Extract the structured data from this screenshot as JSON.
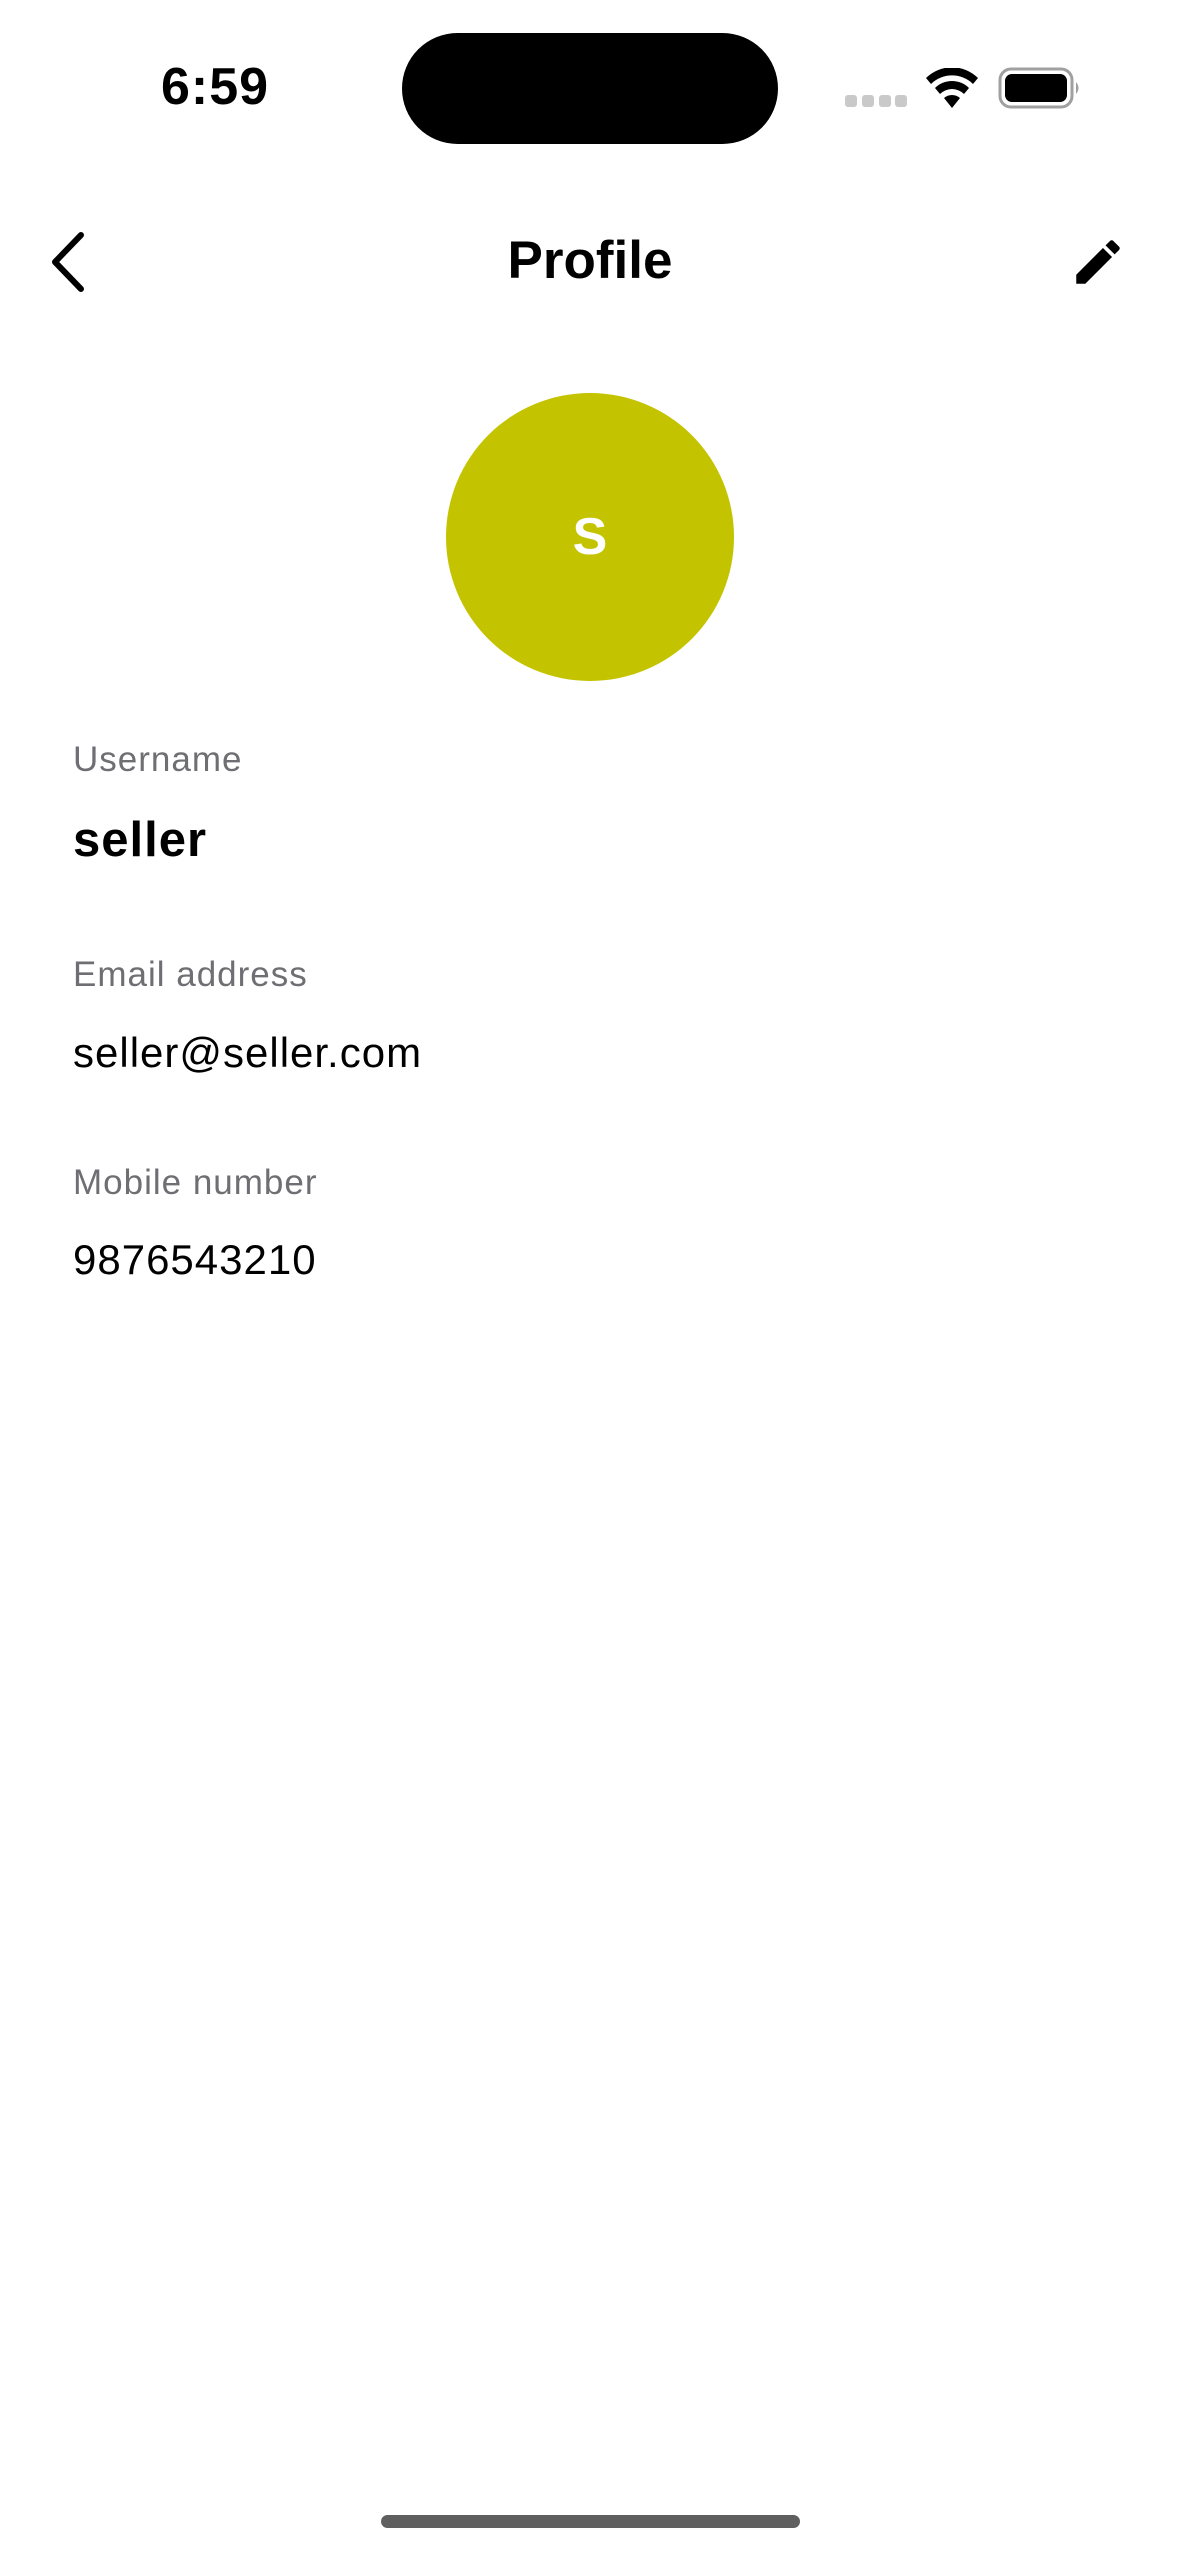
{
  "status_bar": {
    "time": "6:59",
    "icons": [
      "signal-icon",
      "wifi-icon",
      "battery-icon"
    ]
  },
  "nav": {
    "title": "Profile",
    "back_icon": "chevron-left-icon",
    "edit_icon": "pencil-icon"
  },
  "avatar": {
    "initial": "S",
    "color": "#c4c300"
  },
  "fields": {
    "username": {
      "label": "Username",
      "value": "seller"
    },
    "email": {
      "label": "Email address",
      "value": "seller@seller.com"
    },
    "mobile": {
      "label": "Mobile number",
      "value": "9876543210"
    }
  }
}
